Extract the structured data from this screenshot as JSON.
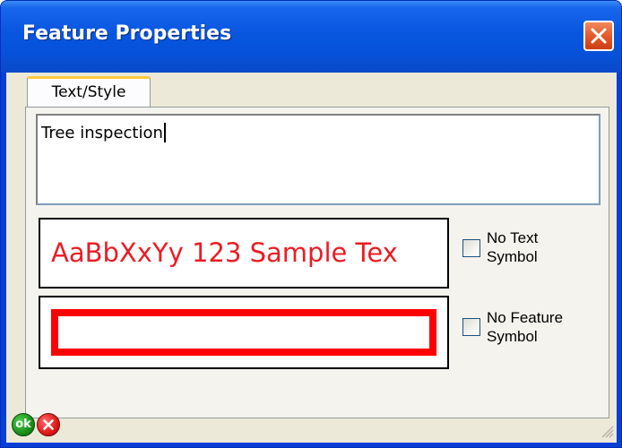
{
  "window": {
    "title": "Feature Properties",
    "title_bar_color": "#0856e0",
    "client_bg_color": "#ece9d8"
  },
  "tabs": [
    {
      "label": "Text/Style",
      "selected": true
    }
  ],
  "text_input": {
    "value": "Tree inspection"
  },
  "text_sample": {
    "preview_text": "AaBbXxYy 123 Sample Tex",
    "color": "#ec1c24"
  },
  "feature_sample": {
    "border_color": "#ff0000"
  },
  "options": {
    "no_text_symbol": {
      "label_line1": "No Text",
      "label_line2": "Symbol",
      "checked": false
    },
    "no_feature_symbol": {
      "label_line1": "No Feature",
      "label_line2": "Symbol",
      "checked": false
    }
  },
  "buttons": {
    "ok_label": "ok",
    "ok_icon": "ok-icon",
    "cancel_icon": "cancel-x-icon",
    "close_icon": "close-x-icon"
  }
}
